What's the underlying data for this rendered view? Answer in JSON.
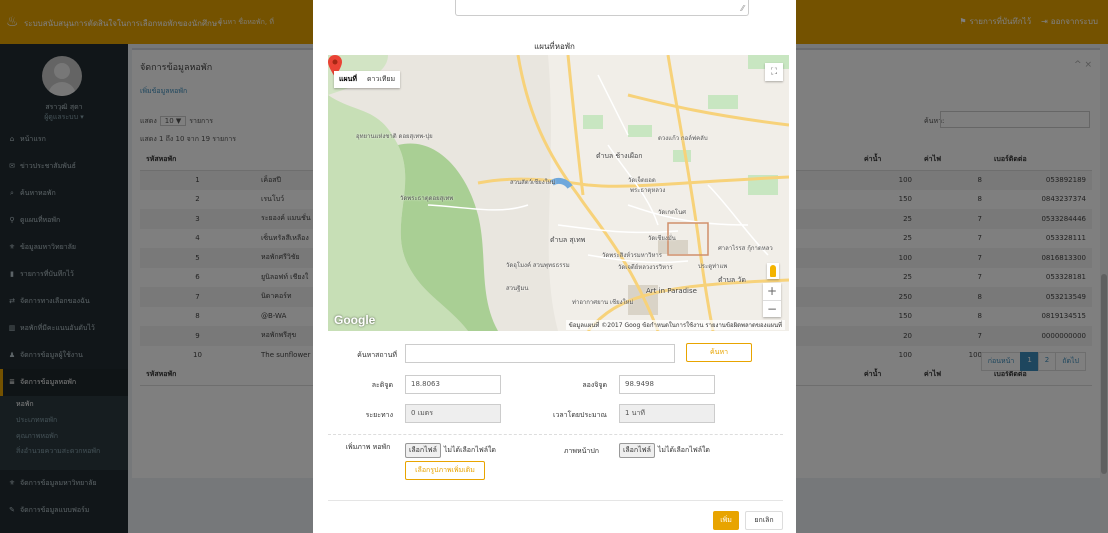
{
  "header": {
    "title": "ระบบสนับสนุนการตัดสินใจในการเลือกหอพักของนักศึกษา",
    "subtitle": "ค้นหา ชื่อหอพัก, ที่",
    "right_report": "รายการที่บันทึกไว้",
    "right_logout": "ออกจากระบบ"
  },
  "sidebar": {
    "user_name": "สราวุฒิ สุดา",
    "user_role": "ผู้ดูแลระบบ ▾",
    "items": [
      {
        "icon": "home-icon",
        "label": "หน้าแรก"
      },
      {
        "icon": "megaphone-icon",
        "label": "ข่าวประชาสัมพันธ์"
      },
      {
        "icon": "search-icon",
        "label": "ค้นหาหอพัก"
      },
      {
        "icon": "map-marker-icon",
        "label": "ดูแผนที่หอพัก"
      },
      {
        "icon": "graduation-icon",
        "label": "ข้อมูลมหาวิทยาลัย"
      },
      {
        "icon": "bookmark-icon",
        "label": "รายการที่บันทึกไว้"
      },
      {
        "icon": "exchange-icon",
        "label": "จัดการทางเลือกของฉัน"
      },
      {
        "icon": "bar-chart-icon",
        "label": "หอพักที่มีคะแนนอันดับไว้"
      },
      {
        "icon": "user-icon",
        "label": "จัดการข้อมูลผู้ใช้งาน"
      },
      {
        "icon": "list-icon",
        "label": "จัดการข้อมูลหอพัก"
      }
    ],
    "sub_items": [
      "หอพัก",
      "ประเภทหอพัก",
      "คุณภาพหอพัก",
      "สิ่งอำนวยความสะดวกหอพัก"
    ],
    "items_after": [
      {
        "icon": "graduation-icon",
        "label": "จัดการข้อมูลมหาวิทยาลัย"
      },
      {
        "icon": "edit-icon",
        "label": "จัดการข้อมูลแบบฟอร์ม"
      }
    ]
  },
  "content": {
    "box_title": "จัดการข้อมูลหอพัก",
    "box_tools": "^ ×",
    "add_link": "เพิ่มข้อมูลหอพัก",
    "show_prefix": "แสดง",
    "show_value": "10 ▼",
    "show_suffix": "รายการ",
    "info": "แสดง 1 ถึง 10 จาก 19 รายการ",
    "search_label": "ค้นหา:",
    "columns": [
      "รหัสหอพัก",
      "",
      "",
      "ค่าน้ำ",
      "ค่าไฟ",
      "เบอร์ติดต่อ"
    ],
    "rows": [
      {
        "id": "1",
        "name": "เค็อสปี",
        "water": "100",
        "elec": "8",
        "phone": "053892189"
      },
      {
        "id": "2",
        "name": "เรนโบว์",
        "water": "150",
        "elec": "8",
        "phone": "0843237374"
      },
      {
        "id": "3",
        "name": "ระยองค์ แมนชั่น",
        "water": "25",
        "elec": "7",
        "phone": "0533284446"
      },
      {
        "id": "4",
        "name": "เซ็นทรัลสีเหลือง",
        "water": "25",
        "elec": "7",
        "phone": "053328111"
      },
      {
        "id": "5",
        "name": "หอพักศรีวิชัย",
        "water": "100",
        "elec": "7",
        "phone": "0816813300"
      },
      {
        "id": "6",
        "name": "ยูนิลอฟท์ เชียงใ",
        "water": "25",
        "elec": "7",
        "phone": "053328181"
      },
      {
        "id": "7",
        "name": "นิดาคอร์ท",
        "water": "250",
        "elec": "8",
        "phone": "053213549"
      },
      {
        "id": "8",
        "name": "@B-WA",
        "water": "150",
        "elec": "8",
        "phone": "0819134515"
      },
      {
        "id": "9",
        "name": "หอพักพรีสุข",
        "water": "20",
        "elec": "7",
        "phone": "0000000000"
      },
      {
        "id": "10",
        "name": "The sunflower",
        "water": "100",
        "elec": "100",
        "phone": "0925416446"
      }
    ],
    "footer_columns": [
      "รหัสหอพัก",
      "",
      "",
      "ค่าน้ำ",
      "ค่าไฟ",
      "เบอร์ติดต่อ"
    ],
    "pager": [
      "ก่อนหน้า",
      "1",
      "2",
      "ถัดไป"
    ]
  },
  "modal": {
    "map_title": "แผนที่หอพัก",
    "map_type_map": "แผนที่",
    "map_type_sat": "ดาวเทียม",
    "google": "Google",
    "attribution": "ข้อมูลแผนที่ ©2017 Goog ข้อกำหนดในการใช้งาน รายงานข้อผิดพลาดของแผนที่",
    "map_labels": [
      "อุทยานแห่งชาติ ดอยสุเทพ-ปุย",
      "ตำบล ช้างเผือก",
      "ดวงแก้ว กอล์ฟคลับ",
      "สวนสัตว์เชียงใหม่",
      "วัดพระธาตุดอยสุเทพ",
      "วัดเจ็ดยอด",
      "พระธาตุหลวง",
      "วัดเกตโนศ",
      "ตำบล สุเทพ",
      "วัดเชียงมั่น",
      "วัดพระสิงห์วรมหาวิหาร",
      "ศาลาไรรส กุ้กาดหลว",
      "วัดอุโมงค์ สวนพุทธธรรม",
      "วัดเจดีย์หลวงวรวิหาร",
      "ประตูท่าแพ",
      "ตำบล วัด",
      "สวนฐิมน",
      "Art in Paradise",
      "ท่าอากาศยาน เชียงใหม่"
    ],
    "search_label": "ค้นหาสถานที่",
    "search_value": "",
    "search_button": "ค้นหา",
    "lat_label": "ละติจูด",
    "lat_value": "18.8063",
    "lng_label": "ลองจิจูด",
    "lng_value": "98.9498",
    "distance_label": "ระยะทาง",
    "distance_value": "0 เมตร",
    "time_label": "เวลาโดยประมาณ",
    "time_value": "1 นาที",
    "images_label": "เพิ่มภาพ หอพัก",
    "choose_file": "เลือกไฟล์",
    "no_file": "ไม่ได้เลือกไฟล์ใด",
    "add_more": "เลือกรูปภาพเพิ่มเติม",
    "cover_label": "ภาพหน้าปก",
    "save_button": "เพิ่ม",
    "cancel_button": "ยกเลิก"
  }
}
